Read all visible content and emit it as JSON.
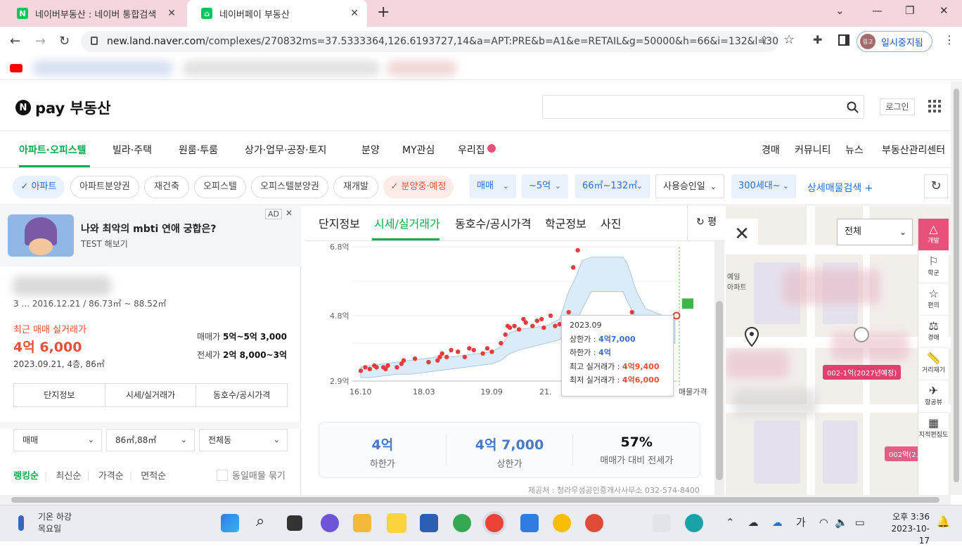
{
  "browser": {
    "tabs": [
      {
        "label": "네이버부동산 : 네이버 통합검색",
        "icon": "N"
      },
      {
        "label": "네이버페이 부동산",
        "icon": "home"
      }
    ],
    "url_host": "new.land.naver.com",
    "url_path": "/complexes/270832ms=37.5333364,126.6193727,14&a=APT:PRE&b=A1&e=RETAIL&g=50000&h=66&i=132&l=300",
    "profile_label": "일시중지됨",
    "profile_avatar": "링고"
  },
  "header": {
    "logo_text": "pay 부동산",
    "login_label": "로그인"
  },
  "menu": {
    "items": [
      "아파트·오피스텔",
      "빌라·주택",
      "원룸·투룸",
      "상가·업무·공장·토지",
      "분양",
      "MY관심",
      "우리집"
    ],
    "right_items": [
      "경매",
      "커뮤니티",
      "뉴스",
      "부동산관리센터"
    ]
  },
  "filters": {
    "chips": [
      "✓ 아파트",
      "아파트분양권",
      "재건축",
      "오피스텔",
      "오피스텔분양권",
      "재개발",
      "✓ 분양중·예정"
    ],
    "dropdowns": [
      "매매",
      "~5억",
      "66㎡~132㎡",
      "사용승인일",
      "300세대~"
    ],
    "detail_search": "상세매물검색 +"
  },
  "ad": {
    "badge": "AD",
    "title": "나와 최악의 mbti 연애 궁합은?",
    "subtitle": "TEST 해보기"
  },
  "complex": {
    "info": "3 ... 2016.12.21 / 86.73㎡ ~ 88.52㎡",
    "recent_label": "최근 매매 실거래가",
    "recent_price": "4억 6,000",
    "recent_detail": "2023.09.21, 4층, 86㎡",
    "sale_label": "매매가 ",
    "sale_value": "5억~5억 3,000",
    "lease_label": "전세가 ",
    "lease_value": "2억 8,000~3억",
    "buttons": [
      "단지정보",
      "시세/실거래가",
      "동호수/공시가격"
    ],
    "selects": [
      "매매",
      "86㎡,88㎡",
      "전체동"
    ],
    "sorts": [
      "랭킹순",
      "최신순",
      "가격순",
      "면적순"
    ],
    "group_label": "동일매물 묶기"
  },
  "detail": {
    "tabs": [
      "단지정보",
      "시세/실거래가",
      "동호수/공시가격",
      "학군정보",
      "사진"
    ],
    "pyeong_label": "평",
    "tooltip": {
      "date": "2023.09",
      "upper_label": "상한가 : ",
      "upper_value": "4억7,000",
      "lower_label": "하한가 : ",
      "lower_value": "4억",
      "max_label": "최고 실거래가 : ",
      "max_value": "4억9,400",
      "min_label": "최저 실거래가 : ",
      "min_value": "4억6,000"
    },
    "summary": [
      {
        "value": "4억",
        "label": "하한가"
      },
      {
        "value": "4억 7,000",
        "label": "상한가"
      },
      {
        "value": "57%",
        "label": "매매가 대비 전세가"
      }
    ],
    "provider": "제공처 : 청라우성공인중개사사무소 032-574-8400"
  },
  "chart_data": {
    "type": "scatter",
    "y_tick_labels": [
      "6.8억",
      "4.8억",
      "2.9억"
    ],
    "x_tick_labels": [
      "16.10",
      "18.03",
      "19.09",
      "21."
    ],
    "x_right_label": "매물가격",
    "ylim": [
      2.9,
      6.8
    ],
    "band_series": {
      "x": [
        2016.8,
        2017.0,
        2017.3,
        2017.6,
        2017.9,
        2018.2,
        2018.5,
        2018.8,
        2019.1,
        2019.4,
        2019.7,
        2019.9,
        2020.1,
        2020.3,
        2020.6,
        2020.9,
        2021.2,
        2021.4,
        2021.55,
        2021.7,
        2021.9,
        2022.2,
        2022.5,
        2022.6,
        2022.7,
        2022.9,
        2023.1,
        2023.3,
        2023.5,
        2023.75
      ],
      "upper": [
        3.3,
        3.35,
        3.4,
        3.45,
        3.5,
        3.55,
        3.6,
        3.6,
        3.65,
        3.7,
        3.75,
        3.9,
        4.3,
        4.4,
        4.45,
        4.5,
        4.7,
        5.5,
        5.9,
        6.4,
        6.5,
        6.5,
        6.5,
        6.5,
        6.3,
        5.5,
        5.0,
        4.9,
        4.8,
        4.7
      ],
      "lower": [
        3.0,
        3.0,
        3.05,
        3.1,
        3.1,
        3.15,
        3.2,
        3.25,
        3.3,
        3.35,
        3.4,
        3.5,
        3.7,
        3.8,
        3.9,
        4.0,
        4.1,
        4.4,
        4.6,
        5.0,
        5.5,
        5.5,
        5.5,
        5.5,
        5.2,
        4.7,
        4.3,
        4.2,
        4.1,
        4.0
      ]
    },
    "trades": {
      "x": [
        2016.8,
        2016.9,
        2017.0,
        2017.1,
        2017.15,
        2017.3,
        2017.35,
        2017.4,
        2017.6,
        2017.7,
        2017.75,
        2018.0,
        2018.3,
        2018.5,
        2018.55,
        2018.6,
        2018.7,
        2018.8,
        2018.95,
        2019.1,
        2019.2,
        2019.3,
        2019.5,
        2019.6,
        2019.7,
        2019.9,
        2020.0,
        2020.05,
        2020.1,
        2020.2,
        2020.3,
        2020.4,
        2020.45,
        2020.6,
        2020.7,
        2020.8,
        2020.85,
        2021.0,
        2021.1,
        2021.2,
        2021.35,
        2021.4,
        2021.5,
        2021.6,
        2022.8
      ],
      "y": [
        3.2,
        3.3,
        3.25,
        3.35,
        3.3,
        3.3,
        3.25,
        3.35,
        3.3,
        3.4,
        3.5,
        3.55,
        3.45,
        3.5,
        3.6,
        3.7,
        3.6,
        3.8,
        3.75,
        3.6,
        3.85,
        3.8,
        3.7,
        3.85,
        3.75,
        4.0,
        4.25,
        4.5,
        4.45,
        4.5,
        4.4,
        4.7,
        4.6,
        4.5,
        4.65,
        4.7,
        4.45,
        4.8,
        4.5,
        4.55,
        4.6,
        4.9,
        6.2,
        6.7,
        4.9
      ]
    }
  },
  "map": {
    "select_label": "전체",
    "tools": [
      "개발",
      "학군",
      "편의",
      "경매",
      "거리재기",
      "항공뷰",
      "지적편집도"
    ],
    "labels": [
      "002-1억(2027년예정)",
      "002억(2..."
    ],
    "place_labels": [
      "예일\n아파트"
    ]
  },
  "taskbar": {
    "weather_line1": "기온 하강",
    "weather_line2": "목요일",
    "time": "오후 3:36",
    "date": "2023-10-17",
    "ime": "가"
  }
}
